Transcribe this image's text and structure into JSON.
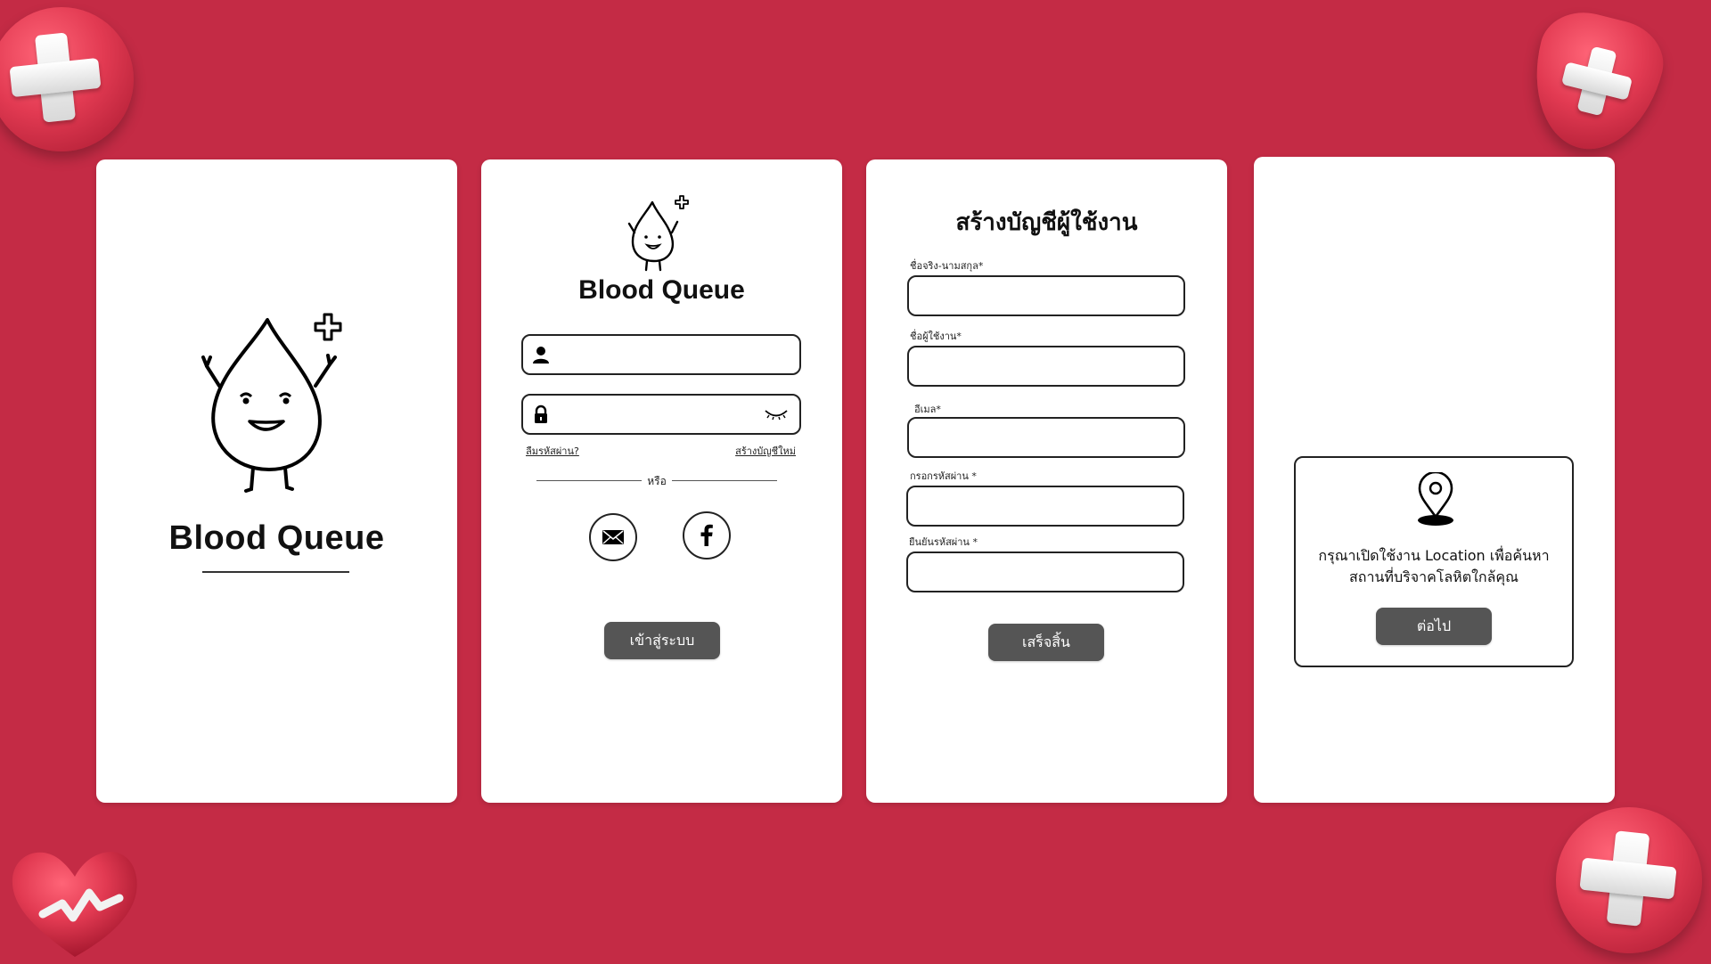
{
  "theme": {
    "background": "#c42b45",
    "accent": "#e23a52",
    "button": "#555555"
  },
  "splash": {
    "app_name": "Blood Queue",
    "mascot_icon": "blood-drop-mascot-icon"
  },
  "login": {
    "app_name": "Blood Queue",
    "username": {
      "icon": "user-icon",
      "value": "",
      "placeholder": ""
    },
    "password": {
      "icon": "lock-icon",
      "value": "",
      "placeholder": "",
      "toggle_icon": "eye-closed-icon"
    },
    "forgot_password": "ลืมรหัสผ่าน?",
    "create_account": "สร้างบัญชีใหม่",
    "or_text": "หรือ",
    "social": [
      {
        "name": "email",
        "icon": "envelope-icon"
      },
      {
        "name": "facebook",
        "icon": "facebook-icon"
      }
    ],
    "submit_label": "เข้าสู่ระบบ"
  },
  "register": {
    "title": "สร้างบัญชีผู้ใช้งาน",
    "fields": [
      {
        "label": "ชื่อจริง-นามสกุล*",
        "value": ""
      },
      {
        "label": "ชื่อผู้ใช้งาน*",
        "value": ""
      },
      {
        "label": "อีเมล*",
        "value": ""
      },
      {
        "label": "กรอกรหัสผ่าน *",
        "value": ""
      },
      {
        "label": "ยืนยันรหัสผ่าน *",
        "value": ""
      }
    ],
    "submit_label": "เสร็จสิ้น"
  },
  "location": {
    "icon": "map-pin-icon",
    "line1": "กรุณาเปิดใช้งาน Location  เพื่อค้นหา",
    "line2": "สถานที่บริจาคโลหิตใกล้คุณ",
    "next_label": "ต่อไป"
  },
  "decorations": [
    "medical-cross-badge-icon",
    "shield-cross-badge-icon",
    "heart-pulse-badge-icon",
    "medical-cross-badge-icon"
  ]
}
